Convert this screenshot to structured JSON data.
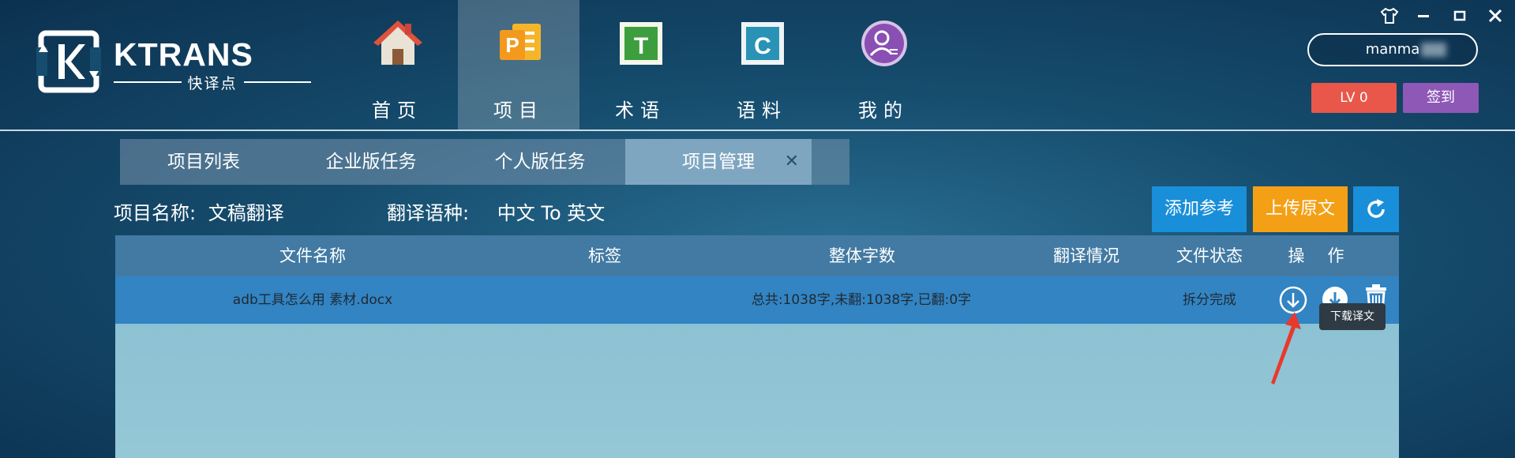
{
  "brand": {
    "name": "KTRANS",
    "subtitle": "快译点"
  },
  "nav": [
    {
      "label": "首页",
      "icon": "home-icon"
    },
    {
      "label": "项目",
      "icon": "project-icon",
      "active": true
    },
    {
      "label": "术语",
      "icon": "terminology-icon"
    },
    {
      "label": "语料",
      "icon": "corpus-icon"
    },
    {
      "label": "我的",
      "icon": "profile-icon"
    }
  ],
  "window_controls": [
    "skin-icon",
    "minimize-icon",
    "maximize-icon",
    "close-icon"
  ],
  "user": {
    "name": "manma",
    "level": "LV 0",
    "sign_in": "签到"
  },
  "subtabs": [
    {
      "label": "项目列表"
    },
    {
      "label": "企业版任务"
    },
    {
      "label": "个人版任务"
    },
    {
      "label": "项目管理",
      "active": true
    }
  ],
  "project": {
    "name_label": "项目名称:",
    "name_value": "文稿翻译",
    "lang_label": "翻译语种:",
    "lang_value": "中文 To 英文"
  },
  "actions": {
    "add_ref": "添加参考",
    "upload": "上传原文"
  },
  "table": {
    "headers": [
      "文件名称",
      "标签",
      "整体字数",
      "翻译情况",
      "文件状态",
      "操",
      "作"
    ],
    "rows": [
      {
        "file_name": "adb工具怎么用 素材.docx",
        "tag": "",
        "word_count": "总共:1038字,未翻:1038字,已翻:0字",
        "progress": "",
        "status": "拆分完成"
      }
    ]
  },
  "tooltip": "下载译文",
  "colors": {
    "accent_blue": "#1a8fd9",
    "upload_orange": "#f4a017",
    "lv_red": "#e8574a",
    "sign_purple": "#8e58b6"
  }
}
